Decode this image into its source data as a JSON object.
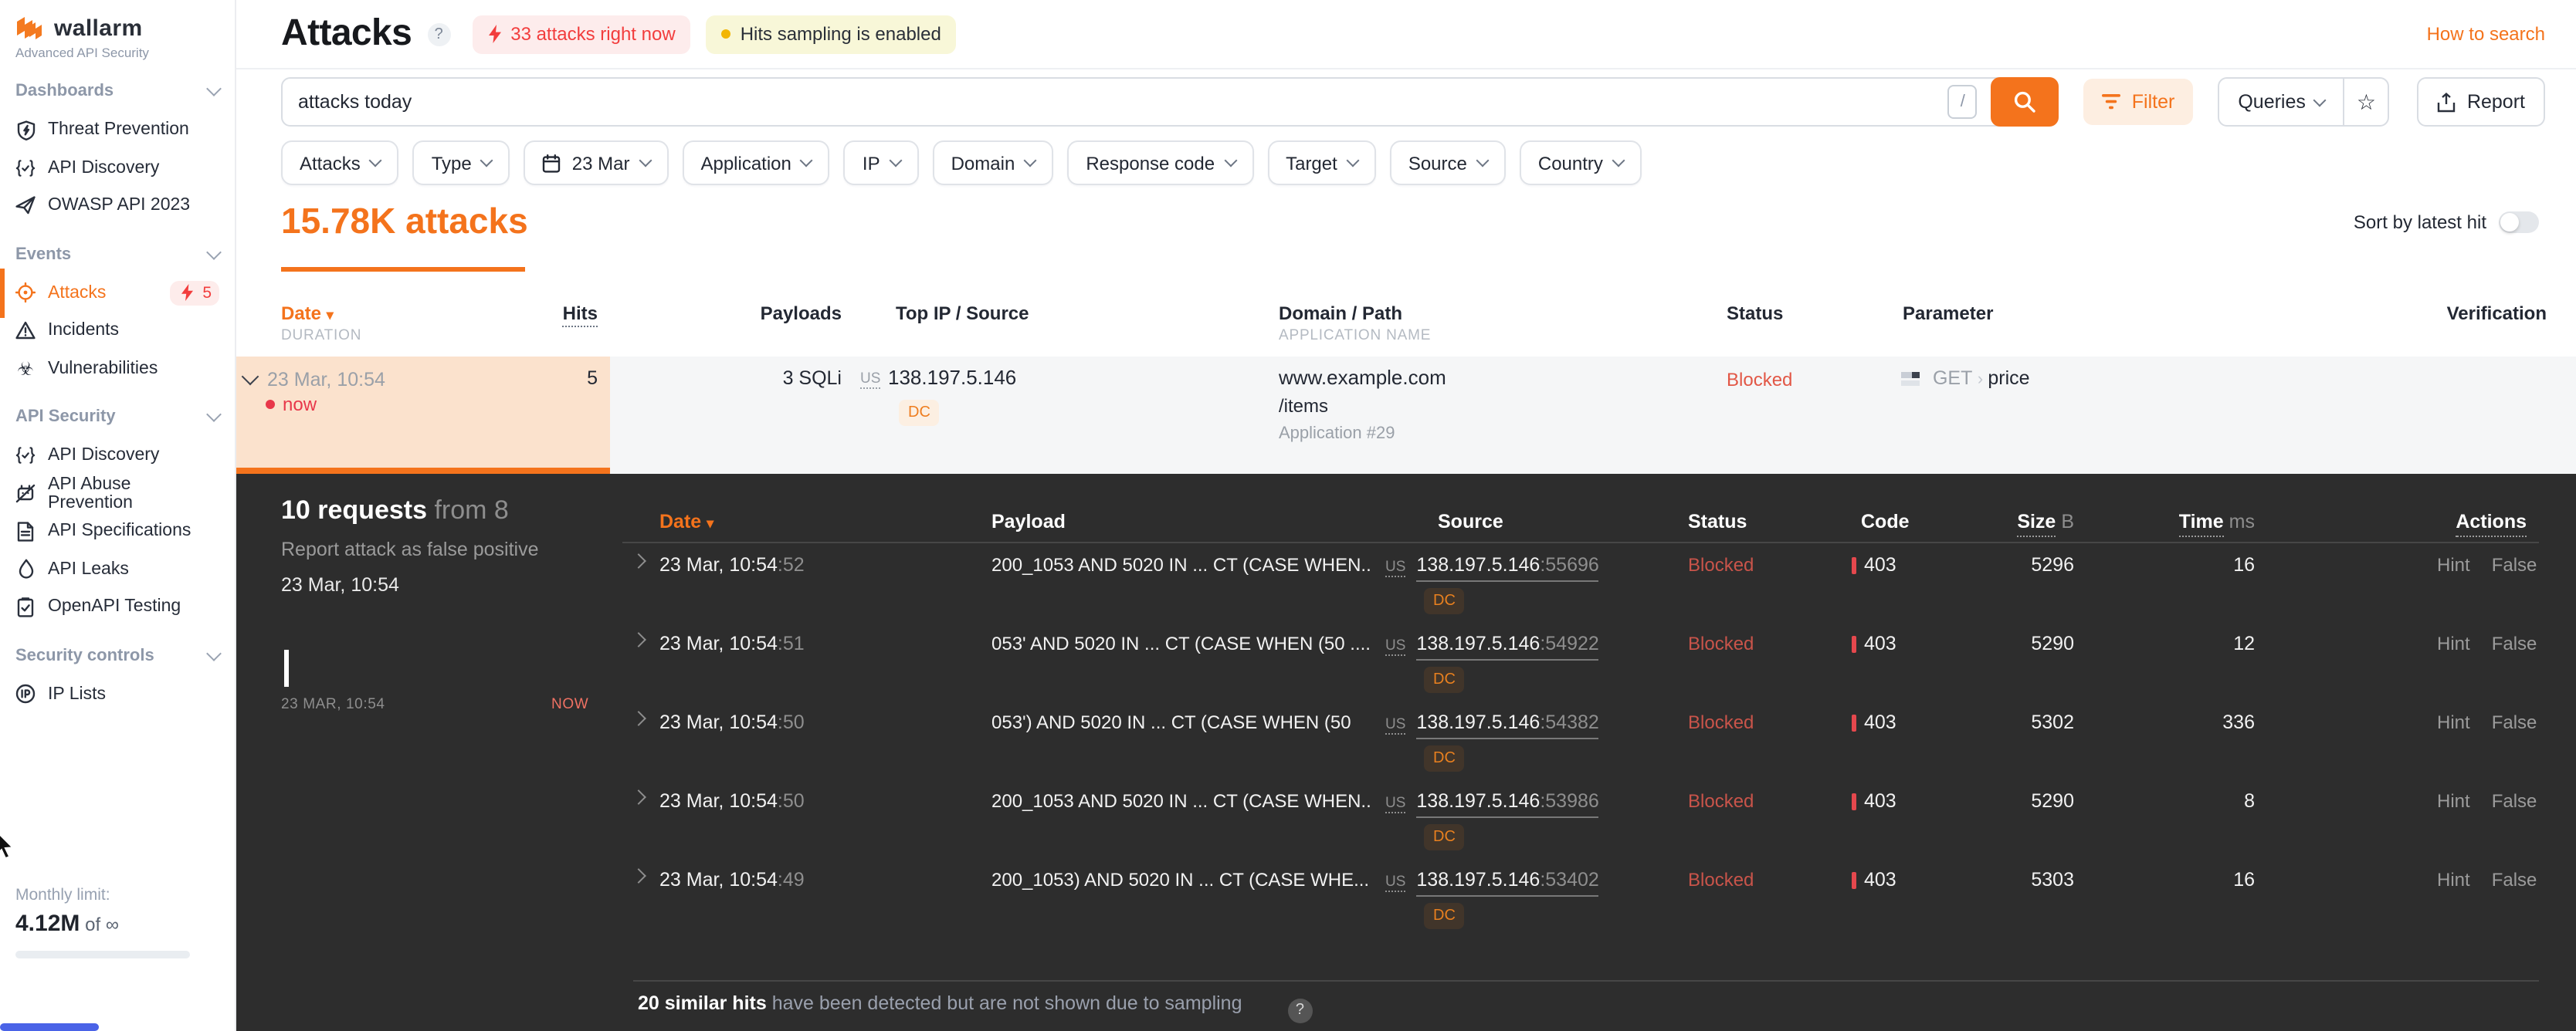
{
  "brand": {
    "logo_text": "wallarm",
    "subtitle": "Advanced API Security"
  },
  "sidebar": {
    "sections": [
      {
        "label": "Dashboards",
        "items": [
          {
            "label": "Threat Prevention",
            "icon": "shield-bolt-icon"
          },
          {
            "label": "API Discovery",
            "icon": "braces-check-icon"
          },
          {
            "label": "OWASP API 2023",
            "icon": "paper-plane-icon"
          }
        ]
      },
      {
        "label": "Events",
        "items": [
          {
            "label": "Attacks",
            "icon": "target-icon",
            "active": true,
            "badge": "5"
          },
          {
            "label": "Incidents",
            "icon": "warning-triangle-icon"
          },
          {
            "label": "Vulnerabilities",
            "icon": "biohazard-icon"
          }
        ]
      },
      {
        "label": "API Security",
        "items": [
          {
            "label": "API Discovery",
            "icon": "braces-check-icon"
          },
          {
            "label": "API Abuse Prevention",
            "icon": "robot-off-icon"
          },
          {
            "label": "API Specifications",
            "icon": "document-icon"
          },
          {
            "label": "API Leaks",
            "icon": "droplet-icon"
          },
          {
            "label": "OpenAPI Testing",
            "icon": "clipboard-check-icon"
          }
        ]
      },
      {
        "label": "Security controls",
        "items": [
          {
            "label": "IP Lists",
            "icon": "ip-circle-icon"
          }
        ]
      }
    ],
    "monthly_limit": {
      "label": "Monthly limit:",
      "used": "4.12M",
      "of_label": "of",
      "total": "∞"
    }
  },
  "header": {
    "title": "Attacks",
    "alert_badge": "33 attacks right now",
    "sampling_badge": "Hits sampling is enabled",
    "help_link": "How to search"
  },
  "toolbar": {
    "search_value": "attacks today",
    "search_shortcut": "/",
    "filter_label": "Filter",
    "queries_label": "Queries",
    "report_label": "Report"
  },
  "filters": [
    {
      "label": "Attacks"
    },
    {
      "label": "Type"
    },
    {
      "label": "23 Mar",
      "icon": "calendar-icon"
    },
    {
      "label": "Application"
    },
    {
      "label": "IP"
    },
    {
      "label": "Domain"
    },
    {
      "label": "Response code"
    },
    {
      "label": "Target"
    },
    {
      "label": "Source"
    },
    {
      "label": "Country"
    }
  ],
  "summary": {
    "count": "15.78K attacks",
    "sort_label": "Sort by latest hit",
    "sort_on": false
  },
  "attack_table": {
    "headers": {
      "date": "Date",
      "duration": "DURATION",
      "hits": "Hits",
      "payloads": "Payloads",
      "source": "Top IP / Source",
      "domain": "Domain / Path",
      "application": "APPLICATION NAME",
      "status": "Status",
      "parameter": "Parameter",
      "verification": "Verification"
    },
    "row": {
      "date": "23 Mar, 10:54",
      "live": "now",
      "hits": "5",
      "payloads": "3 SQLi",
      "country": "US",
      "ip": "138.197.5.146",
      "tag": "DC",
      "domain": "www.example.com",
      "path": "/items",
      "application": "Application #29",
      "status": "Blocked",
      "method": "GET",
      "parameter": "price"
    }
  },
  "details": {
    "requests_count": "10 requests",
    "requests_from": "from 8",
    "report_link": "Report attack as false positive",
    "attack_time": "23 Mar, 10:54",
    "timeline_start": "23 MAR, 10:54",
    "timeline_end": "NOW",
    "headers": {
      "date": "Date",
      "payload": "Payload",
      "source": "Source",
      "status": "Status",
      "code": "Code",
      "size": "Size",
      "size_unit": "B",
      "time": "Time",
      "time_unit": "ms",
      "actions": "Actions"
    },
    "rows": [
      {
        "date": "23 Mar, 10:54",
        "seconds": ":52",
        "payload": "200_1053 AND 5020 IN ... CT (CASE WHEN...",
        "country": "US",
        "ip": "138.197.5.146",
        "port": ":55696",
        "tag": "DC",
        "status": "Blocked",
        "code": "403",
        "size": "5296",
        "time": "16",
        "actions": [
          "Hint",
          "False"
        ]
      },
      {
        "date": "23 Mar, 10:54",
        "seconds": ":51",
        "payload": "053' AND 5020 IN ... CT (CASE WHEN (50 ....",
        "country": "US",
        "ip": "138.197.5.146",
        "port": ":54922",
        "tag": "DC",
        "status": "Blocked",
        "code": "403",
        "size": "5290",
        "time": "12",
        "actions": [
          "Hint",
          "False"
        ]
      },
      {
        "date": "23 Mar, 10:54",
        "seconds": ":50",
        "payload": "053') AND 5020 IN ... CT (CASE WHEN (50",
        "country": "US",
        "ip": "138.197.5.146",
        "port": ":54382",
        "tag": "DC",
        "status": "Blocked",
        "code": "403",
        "size": "5302",
        "time": "336",
        "actions": [
          "Hint",
          "False"
        ]
      },
      {
        "date": "23 Mar, 10:54",
        "seconds": ":50",
        "payload": "200_1053 AND 5020 IN ... CT (CASE WHEN...",
        "country": "US",
        "ip": "138.197.5.146",
        "port": ":53986",
        "tag": "DC",
        "status": "Blocked",
        "code": "403",
        "size": "5290",
        "time": "8",
        "actions": [
          "Hint",
          "False"
        ]
      },
      {
        "date": "23 Mar, 10:54",
        "seconds": ":49",
        "payload": "200_1053) AND 5020 IN ... CT (CASE WHE...",
        "country": "US",
        "ip": "138.197.5.146",
        "port": ":53402",
        "tag": "DC",
        "status": "Blocked",
        "code": "403",
        "size": "5303",
        "time": "16",
        "actions": [
          "Hint",
          "False"
        ]
      }
    ],
    "sampling_note_bold": "20 similar hits",
    "sampling_note_rest": "have been detected but are not shown due to sampling"
  },
  "colors": {
    "accent": "#f4731c",
    "alert_red": "#f23d3d",
    "blocked_light": "#e25746",
    "blocked_dark": "#c9544a",
    "dark_bg": "#2d2d2d",
    "selection_peach": "#fbe2cd",
    "sampling_yellow_bg": "#f8f7d8",
    "blue_bar": "#4a63e7"
  }
}
